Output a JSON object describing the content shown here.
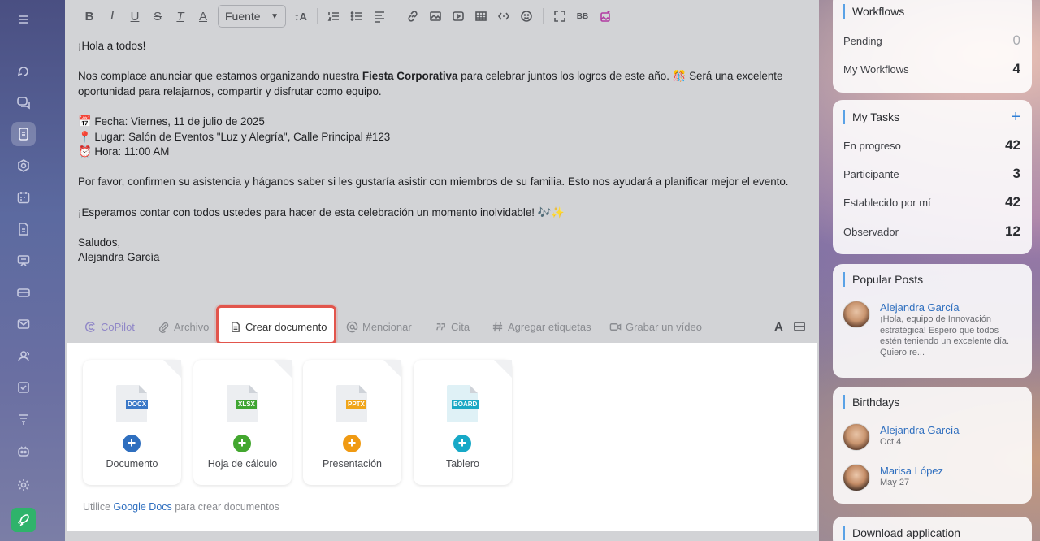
{
  "toolbar": {
    "font_select": "Fuente",
    "bb_code": "BB"
  },
  "message": {
    "greeting": "¡Hola a todos!",
    "intro_before": "Nos complace anunciar que estamos organizando nuestra ",
    "intro_bold": "Fiesta Corporativa",
    "intro_after": " para celebrar juntos los logros de este año. 🎊 Será una excelente oportunidad para relajarnos, compartir y disfrutar como equipo.",
    "date_line": "📅 Fecha: Viernes, 11 de julio de 2025",
    "place_line": "📍 Lugar: Salón de Eventos \"Luz y Alegría\", Calle Principal #123",
    "time_line": "⏰ Hora: 11:00 AM",
    "rsvp": "Por favor, confirmen su asistencia y háganos saber si les gustaría asistir con miembros de su familia. Esto nos ayudará a planificar mejor el evento.",
    "closing": "¡Esperamos contar con todos ustedes para hacer de esta celebración un momento inolvidable! 🎶✨",
    "signoff": "Saludos,",
    "signature": "Alejandra García"
  },
  "actions": {
    "copilot": "CoPilot",
    "archivo": "Archivo",
    "crear_documento": "Crear documento",
    "mencionar": "Mencionar",
    "cita": "Cita",
    "etiquetas": "Agregar etiquetas",
    "video": "Grabar un vídeo",
    "font_letter": "A"
  },
  "create_panel": {
    "cards": [
      {
        "tag": "DOCX",
        "label": "Documento",
        "tag_color": "#3b78c7",
        "plus_color": "#2f6fbf"
      },
      {
        "tag": "XLSX",
        "label": "Hoja de cálculo",
        "tag_color": "#3fa532",
        "plus_color": "#43a72f"
      },
      {
        "tag": "PPTX",
        "label": "Presentación",
        "tag_color": "#f0a51a",
        "plus_color": "#f09a12"
      },
      {
        "tag": "BOARD",
        "label": "Tablero",
        "tag_color": "#1ba8c4",
        "plus_color": "#17a9c7"
      }
    ],
    "hint_before": "Utilice ",
    "hint_link": "Google Docs",
    "hint_after": " para crear documentos"
  },
  "workflows": {
    "title": "Workflows",
    "pending_label": "Pending",
    "pending_value": "0",
    "mine_label": "My Workflows",
    "mine_value": "4"
  },
  "tasks": {
    "title": "My Tasks",
    "add": "+",
    "rows": [
      {
        "label": "En progreso",
        "value": "42"
      },
      {
        "label": "Participante",
        "value": "3"
      },
      {
        "label": "Establecido por mí",
        "value": "42"
      },
      {
        "label": "Observador",
        "value": "12"
      }
    ]
  },
  "popular": {
    "title": "Popular Posts",
    "author": "Alejandra García",
    "excerpt": "¡Hola, equipo de Innovación estratégica! Espero que todos estén teniendo un excelente día. Quiero re..."
  },
  "birthdays": {
    "title": "Birthdays",
    "people": [
      {
        "name": "Alejandra García",
        "date": "Oct 4"
      },
      {
        "name": "Marisa López",
        "date": "May 27"
      }
    ]
  },
  "download": {
    "title": "Download application"
  }
}
